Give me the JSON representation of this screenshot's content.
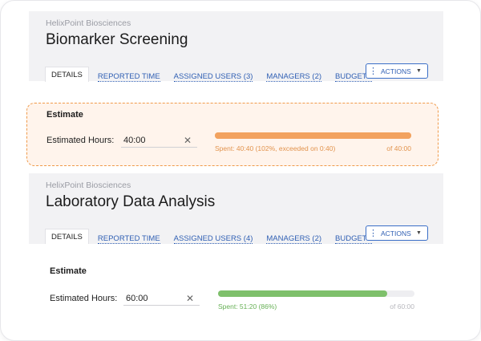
{
  "projects": [
    {
      "company": "HelixPoint Biosciences",
      "title": "Biomarker Screening",
      "tabs": [
        "DETAILS",
        "REPORTED TIME",
        "ASSIGNED USERS (3)",
        "MANAGERS (2)",
        "BUDGETS"
      ],
      "actions_label": "ACTIONS",
      "estimate_title": "Estimate",
      "estimated_hours_label": "Estimated Hours:",
      "estimated_hours_value": "40:00",
      "progress_fraction": 1.0,
      "spent_text": "Spent: 40:40 (102%, exceeded on 0:40)",
      "of_text": "of 40:00",
      "status": "exceeded",
      "status_color": "#f2a25f"
    },
    {
      "company": "HelixPoint Biosciences",
      "title": "Laboratory Data Analysis",
      "tabs": [
        "DETAILS",
        "REPORTED TIME",
        "ASSIGNED USERS (4)",
        "MANAGERS (2)",
        "BUDGETS"
      ],
      "actions_label": "ACTIONS",
      "estimate_title": "Estimate",
      "estimated_hours_label": "Estimated Hours:",
      "estimated_hours_value": "60:00",
      "progress_fraction": 0.86,
      "spent_text": "Spent: 51:20 (86%)",
      "of_text": "of 60:00",
      "status": "ok",
      "status_color": "#7ec06b"
    }
  ],
  "icons": {
    "actions": "vertical-dots-icon",
    "dropdown": "chevron-down-icon",
    "clear": "close-icon"
  }
}
